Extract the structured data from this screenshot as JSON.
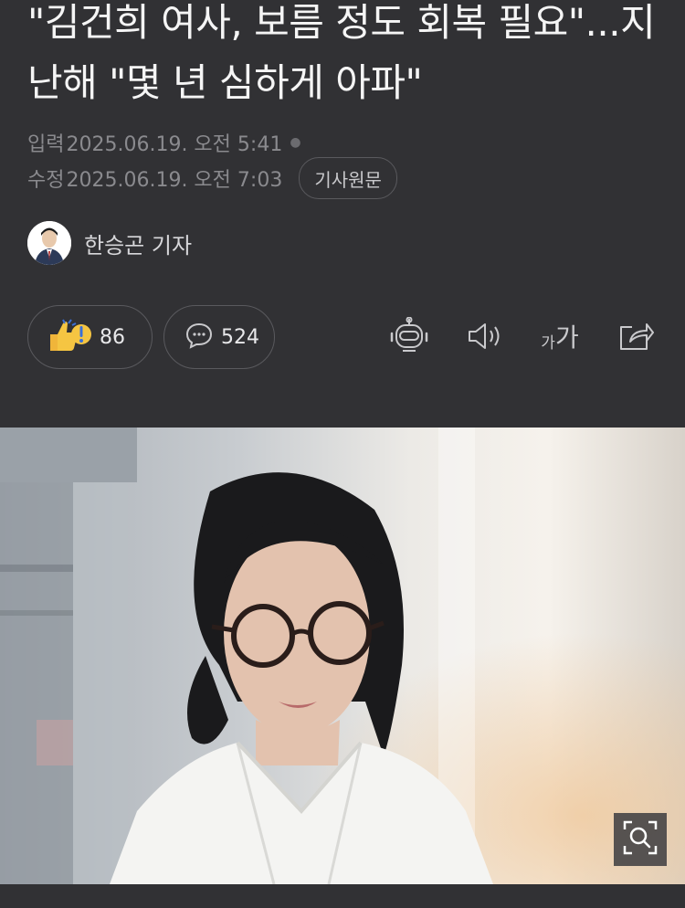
{
  "article": {
    "title": "\"김건희 여사, 보름 정도 회복 필요\"...지난해 \"몇 년 심하게 아파\"",
    "input_label": "입력",
    "input_time": "2025.06.19. 오전 5:41",
    "edit_label": "수정",
    "edit_time": "2025.06.19. 오전 7:03",
    "original_button": "기사원문",
    "author": "한승곤 기자"
  },
  "actions": {
    "reactions_count": "86",
    "comments_count": "524",
    "font_size_label_small": "가",
    "font_size_label_large": "가"
  },
  "icons": {
    "reaction": "thumbs-up-emoji-icon",
    "comment": "comment-bubble-icon",
    "ai_summary": "robot-icon",
    "tts": "speaker-icon",
    "font": "font-size-icon",
    "share": "share-icon",
    "zoom": "zoom-magnifier-icon"
  },
  "colors": {
    "background": "#313134",
    "title": "#f5f5f5",
    "meta": "#8a8a8e"
  }
}
